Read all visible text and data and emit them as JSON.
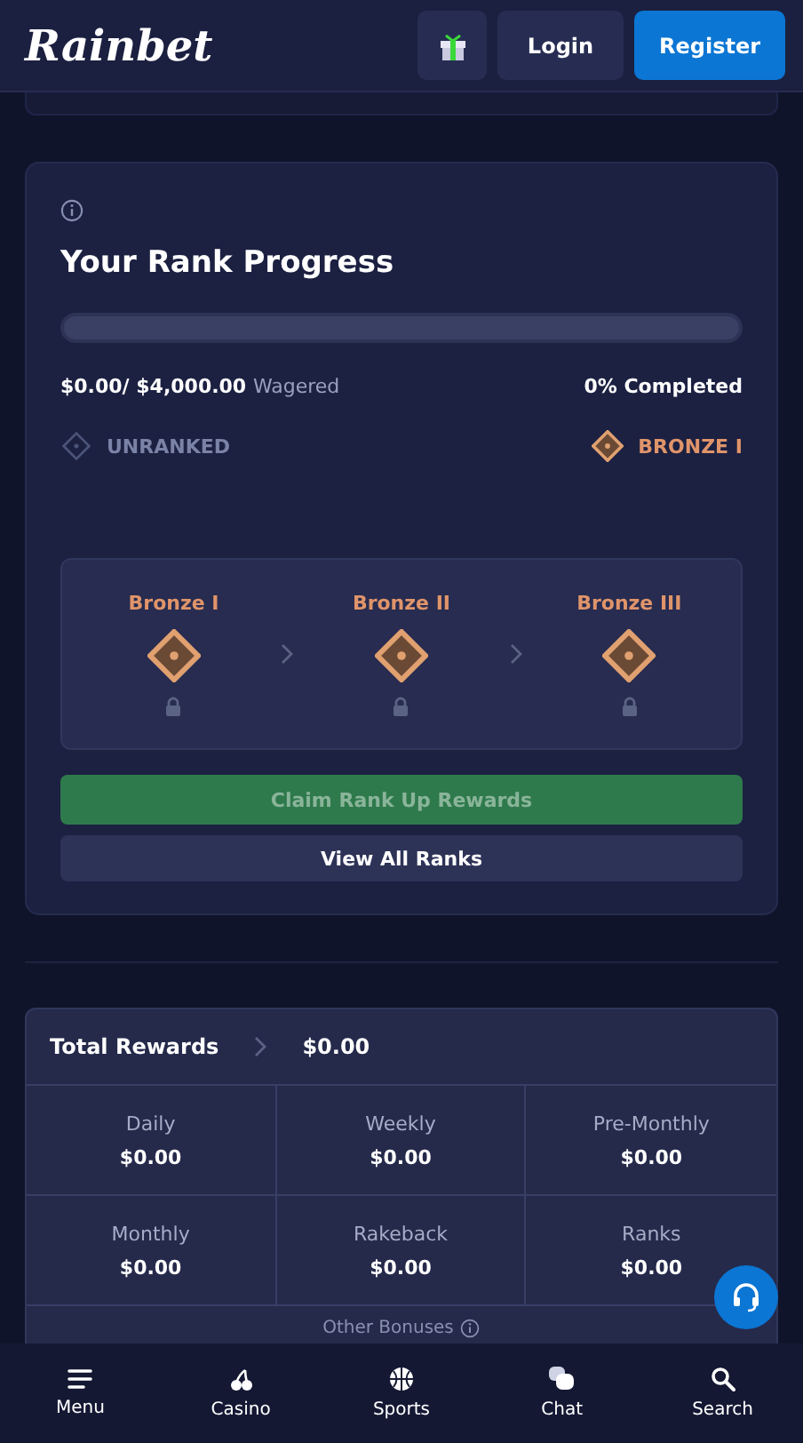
{
  "header": {
    "logo": "Rainbet",
    "buttons": [
      {
        "label": "Login",
        "kind": "secondary"
      },
      {
        "label": "Register",
        "kind": "primary"
      }
    ]
  },
  "rank_progress": {
    "title": "Your Rank Progress",
    "wagered": "$0.00/",
    "target": "$4,000.00",
    "wagered_label": "Wagered",
    "completed": "0% Completed",
    "current_rank": {
      "label": "UNRANKED",
      "kind": "unranked"
    },
    "next_rank": {
      "label": "BRONZE I",
      "kind": "bronze"
    },
    "tiers": [
      {
        "name": "Bronze I",
        "locked": true
      },
      {
        "name": "Bronze II",
        "locked": true
      },
      {
        "name": "Bronze III",
        "locked": true
      }
    ],
    "claim_button": {
      "label": "Claim Rank Up Rewards",
      "disabled": true
    },
    "view_button": {
      "label": "View All Ranks"
    }
  },
  "rewards": {
    "title": "Total Rewards",
    "total": "$0.00",
    "items": [
      {
        "label": "Daily",
        "value": "$0.00"
      },
      {
        "label": "Weekly",
        "value": "$0.00"
      },
      {
        "label": "Pre-Monthly",
        "value": "$0.00"
      },
      {
        "label": "Monthly",
        "value": "$0.00"
      },
      {
        "label": "Rakeback",
        "value": "$0.00"
      },
      {
        "label": "Ranks",
        "value": "$0.00"
      }
    ],
    "other": "Other Bonuses"
  },
  "bottom_nav": [
    {
      "label": "Menu",
      "kind": "menu"
    },
    {
      "label": "Casino",
      "kind": "casino"
    },
    {
      "label": "Sports",
      "kind": "sports"
    },
    {
      "label": "Chat",
      "kind": "chat"
    },
    {
      "label": "Search",
      "kind": "search"
    }
  ]
}
